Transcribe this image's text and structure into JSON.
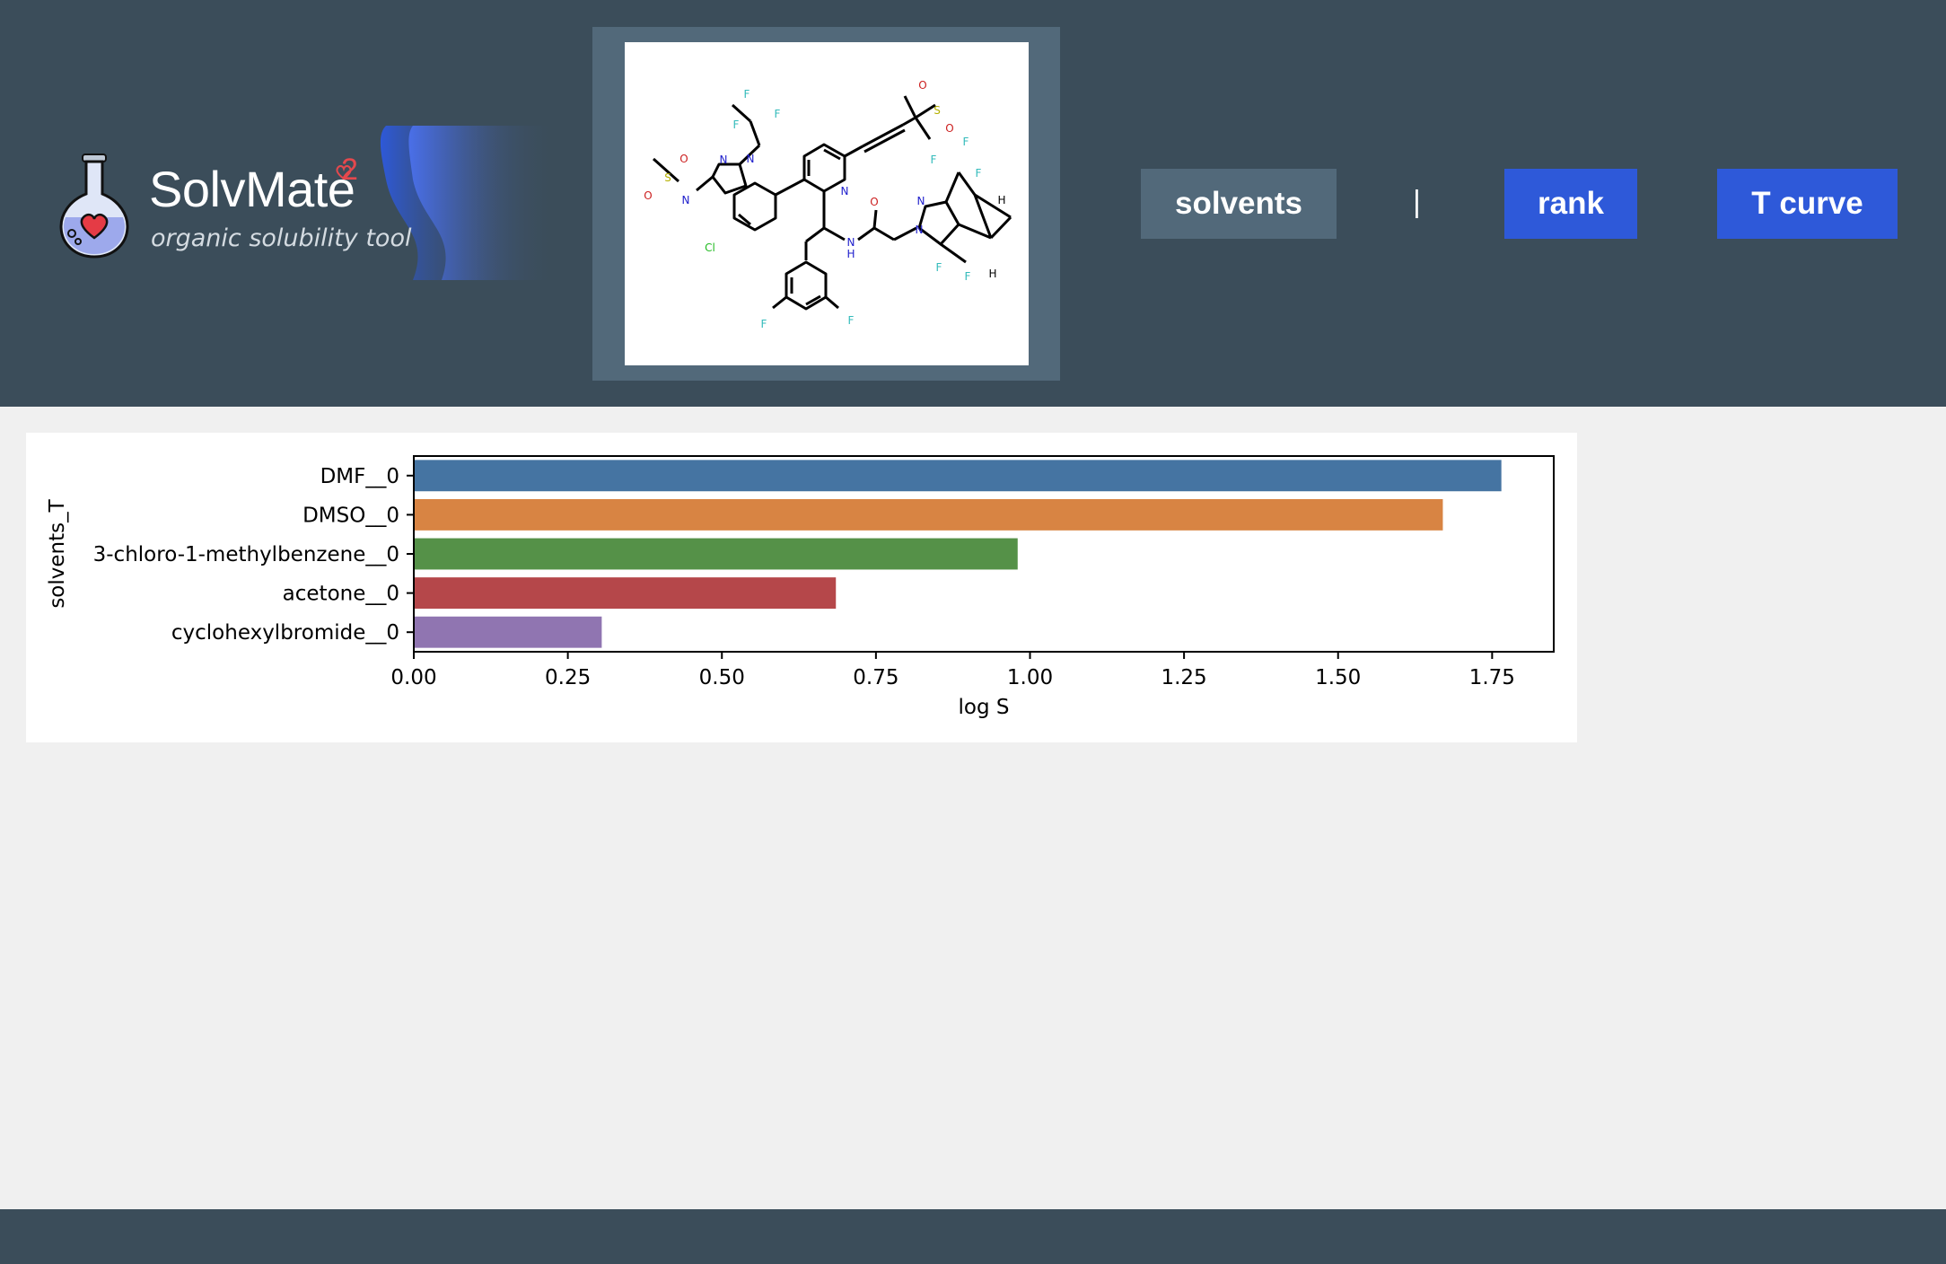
{
  "header": {
    "app_name": "SolvMate",
    "app_superscript": "2",
    "tagline": "organic solubility tool",
    "logo_icon": "flask-heart-icon",
    "background_color": "#3b4d5a"
  },
  "molecule": {
    "atom_labels": [
      "F",
      "F",
      "F",
      "N",
      "N",
      "N",
      "H",
      "O",
      "O",
      "S",
      "Cl",
      "N",
      "H",
      "N",
      "O",
      "N",
      "N",
      "F",
      "F",
      "F",
      "F",
      "F",
      "H",
      "H",
      "O",
      "O",
      "S",
      "F",
      "F"
    ]
  },
  "nav": {
    "solvents_label": "solvents",
    "separator": "|",
    "rank_label": "rank",
    "tcurve_label": "T curve",
    "active_color": "#52697a",
    "button_color": "#2e59d9"
  },
  "chart_data": {
    "type": "bar",
    "orientation": "horizontal",
    "categories": [
      "DMF__0",
      "DMSO__0",
      "3-chloro-1-methylbenzene__0",
      "acetone__0",
      "cyclohexylbromide__0"
    ],
    "values": [
      1.765,
      1.67,
      0.98,
      0.685,
      0.305
    ],
    "colors": [
      "#4574a2",
      "#d88443",
      "#559148",
      "#b5474a",
      "#9075b1"
    ],
    "xlabel": "log S",
    "ylabel": "solvents_T",
    "xlim": [
      0,
      1.85
    ],
    "xticks": [
      0.0,
      0.25,
      0.5,
      0.75,
      1.0,
      1.25,
      1.5,
      1.75
    ],
    "xtick_labels": [
      "0.00",
      "0.25",
      "0.50",
      "0.75",
      "1.00",
      "1.25",
      "1.50",
      "1.75"
    ],
    "grid": false
  }
}
